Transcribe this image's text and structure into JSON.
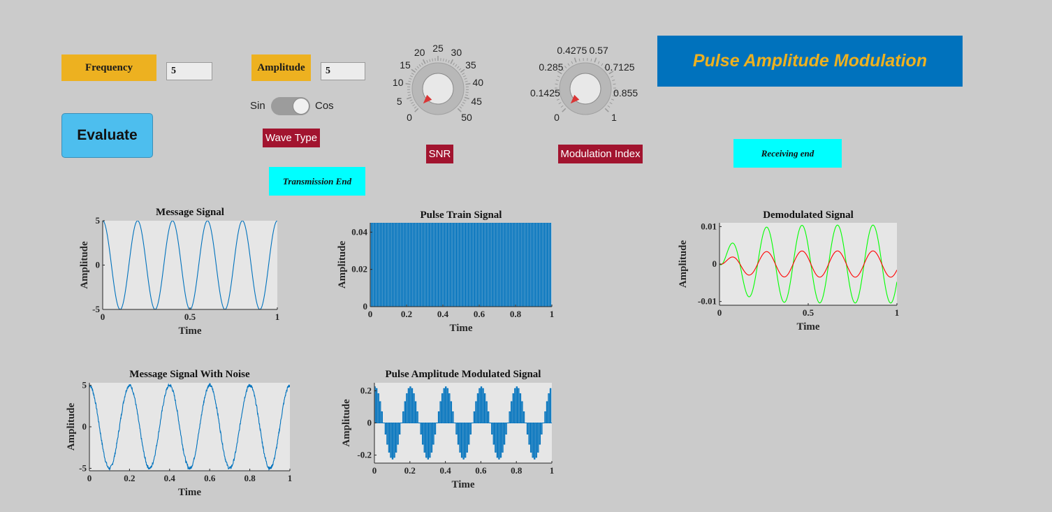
{
  "frequency": {
    "label": "Frequency",
    "value": "5"
  },
  "amplitude": {
    "label": "Amplitude",
    "value": "5"
  },
  "evaluate": {
    "label": "Evaluate"
  },
  "wave_switch": {
    "off_label": "Sin",
    "on_label": "Cos",
    "state": "Sin",
    "caption": "Wave Type"
  },
  "snr": {
    "label": "SNR",
    "ticks": [
      "0",
      "5",
      "10",
      "15",
      "20",
      "25",
      "30",
      "35",
      "40",
      "45",
      "50"
    ],
    "value": 0
  },
  "mod_index": {
    "label": "Modulation Index",
    "ticks": [
      "0",
      "0.1425",
      "0.285",
      "0.4275",
      "0.57",
      "0.7125",
      "0.855",
      "1"
    ],
    "value": 0
  },
  "title": "Pulse Amplitude Modulation",
  "transmission_label": "Transmission End",
  "receiving_label": "Receiving end",
  "colors": {
    "orange": "#edb120",
    "blue": "#0072bd",
    "red": "#a2142f",
    "cyan": "#00ffff",
    "green": "#00ff00",
    "signal": "#0072bd"
  },
  "chart_data": [
    {
      "id": "message",
      "type": "line",
      "title": "Message Signal",
      "xlabel": "Time",
      "ylabel": "Amplitude",
      "xlim": [
        0,
        1
      ],
      "ylim": [
        -5,
        5
      ],
      "xticks": [
        "0",
        "0.5",
        "1"
      ],
      "yticks": [
        "-5",
        "0",
        "5"
      ],
      "series": [
        {
          "kind": "cos",
          "amplitude": 5,
          "frequency": 5,
          "color": "#0072bd"
        }
      ]
    },
    {
      "id": "pulse",
      "type": "line",
      "title": "Pulse Train Signal",
      "xlabel": "Time",
      "ylabel": "Amplitude",
      "xlim": [
        0,
        1
      ],
      "ylim": [
        0,
        0.045
      ],
      "xticks": [
        "0",
        "0.2",
        "0.4",
        "0.6",
        "0.8",
        "1"
      ],
      "yticks": [
        "0",
        "0.02",
        "0.04"
      ],
      "series": [
        {
          "kind": "pulse",
          "amplitude": 0.045,
          "pulses": 100,
          "color": "#0072bd"
        }
      ]
    },
    {
      "id": "demod",
      "type": "line",
      "title": "Demodulated Signal",
      "xlabel": "Time",
      "ylabel": "Amplitude",
      "xlim": [
        0,
        1
      ],
      "ylim": [
        -0.011,
        0.011
      ],
      "xticks": [
        "0",
        "0.5",
        "1"
      ],
      "yticks": [
        "-0.01",
        "0",
        "0.01"
      ],
      "series": [
        {
          "kind": "demod",
          "amplitude": 0.0104,
          "frequency": 5,
          "color": "#00ff00"
        },
        {
          "kind": "demod",
          "amplitude": 0.0035,
          "frequency": 5,
          "color": "#ff0000"
        }
      ]
    },
    {
      "id": "noise",
      "type": "line",
      "title": "Message Signal With Noise",
      "xlabel": "Time",
      "ylabel": "Amplitude",
      "xlim": [
        0,
        1
      ],
      "ylim": [
        -5.3,
        5.3
      ],
      "xticks": [
        "0",
        "0.2",
        "0.4",
        "0.6",
        "0.8",
        "1"
      ],
      "yticks": [
        "-5",
        "0",
        "5"
      ],
      "series": [
        {
          "kind": "noisycos",
          "amplitude": 5,
          "frequency": 5,
          "noise": 0.2,
          "color": "#0072bd"
        }
      ]
    },
    {
      "id": "pam",
      "type": "line",
      "title": "Pulse Amplitude Modulated Signal",
      "xlabel": "Time",
      "ylabel": "Amplitude",
      "xlim": [
        0,
        1
      ],
      "ylim": [
        -0.25,
        0.25
      ],
      "xticks": [
        "0",
        "0.2",
        "0.4",
        "0.6",
        "0.8",
        "1"
      ],
      "yticks": [
        "-0.2",
        "0",
        "0.2"
      ],
      "series": [
        {
          "kind": "pam",
          "amplitude": 0.225,
          "frequency": 5,
          "pulses": 100,
          "color": "#0072bd"
        }
      ]
    }
  ]
}
